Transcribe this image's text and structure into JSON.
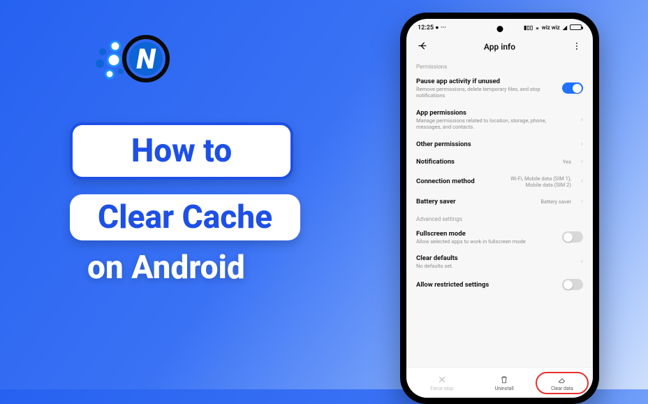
{
  "brand": {
    "letter": "N"
  },
  "left": {
    "howto": "How to",
    "clear_cache": "Clear Cache",
    "on_android": "on Android"
  },
  "status": {
    "time": "12:25",
    "wifi_label": "wiz wiz"
  },
  "appbar": {
    "title": "App info"
  },
  "sections": {
    "permissions_label": "Permissions",
    "advanced_label": "Advanced settings"
  },
  "items": {
    "pause": {
      "title": "Pause app activity if unused",
      "sub": "Remove permissions, delete temporary files, and stop notifications",
      "on": true
    },
    "app_permissions": {
      "title": "App permissions",
      "sub": "Manage permissions related to location, storage, phone, messages, and contacts."
    },
    "other_permissions": {
      "title": "Other permissions"
    },
    "notifications": {
      "title": "Notifications",
      "value": "Yes"
    },
    "connection": {
      "title": "Connection method",
      "value": "Wi-Fi, Mobile data (SIM 1), Mobile data (SIM 2)"
    },
    "battery": {
      "title": "Battery saver",
      "value": "Battery saver"
    },
    "fullscreen": {
      "title": "Fullscreen mode",
      "sub": "Allow selected apps to work in fullscreen mode",
      "on": false
    },
    "clear_defaults": {
      "title": "Clear defaults",
      "sub": "No defaults set."
    },
    "allow_restricted": {
      "title": "Allow restricted settings",
      "on": false
    }
  },
  "bottom": {
    "force_stop": "Force stop",
    "uninstall": "Uninstall",
    "clear_data": "Clear data"
  },
  "colors": {
    "brand_blue": "#1e50e6",
    "toggle_on": "#1f72ff",
    "highlight_red": "#e5302a"
  }
}
